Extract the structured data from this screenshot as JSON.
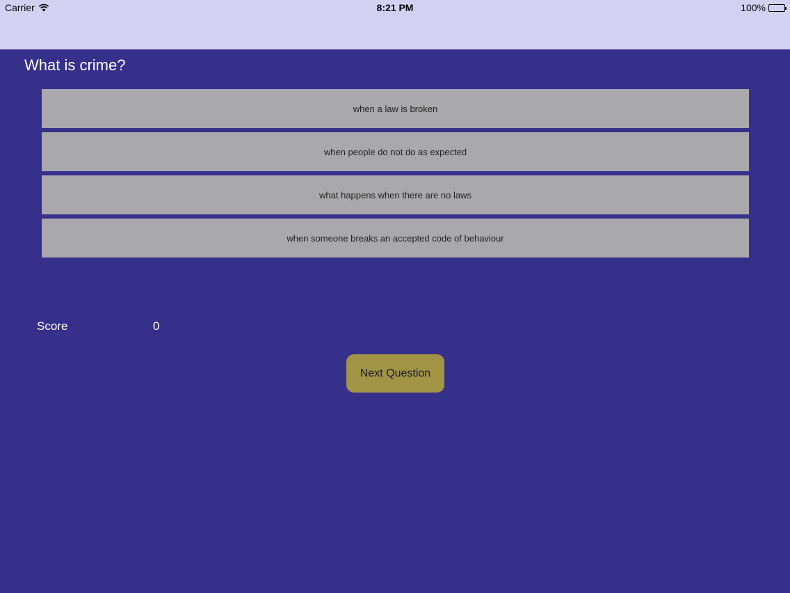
{
  "status_bar": {
    "carrier": "Carrier",
    "time": "8:21 PM",
    "battery": "100%"
  },
  "quiz": {
    "question": "What is crime?",
    "answers": [
      "when a law is broken",
      "when people do not do as expected",
      "what happens when there are no laws",
      "when someone breaks an accepted code of behaviour"
    ],
    "score_label": "Score",
    "score_value": "0",
    "next_label": "Next Question"
  },
  "colors": {
    "background": "#37308b",
    "status_bar": "#d3d1f2",
    "answer_button": "#a9a8ac",
    "next_button": "#a19445"
  }
}
